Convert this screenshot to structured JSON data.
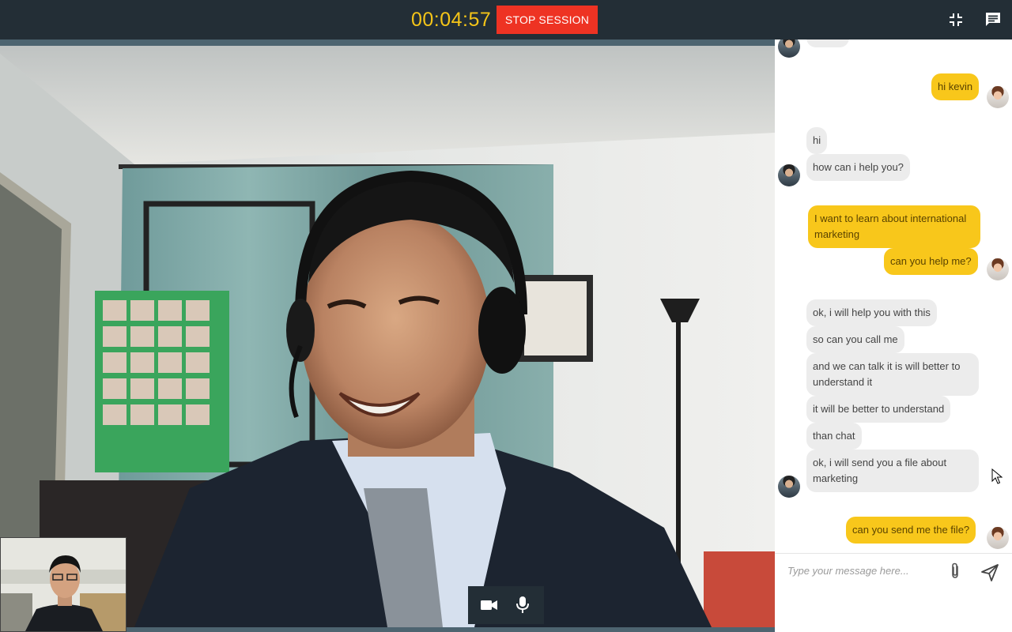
{
  "header": {
    "timer": "00:04:57",
    "stop_button_label": "STOP SESSION",
    "icons": [
      "minimize-icon",
      "chat-icon"
    ],
    "timer_color": "#f5c518",
    "stop_color": "#ee3323"
  },
  "video": {
    "controls": [
      "video-camera-icon",
      "microphone-icon"
    ]
  },
  "chat": {
    "bubble_me_color": "#f8c71b",
    "bubble_them_color": "#ececec",
    "messages": [
      {
        "from": "them",
        "text": "hi"
      },
      {
        "from": "them",
        "text": "how can i help you?"
      },
      {
        "from": "me",
        "text": "hi kevin"
      },
      {
        "from": "me",
        "text": "I want to learn about international marketing"
      },
      {
        "from": "me",
        "text": "can you help me?"
      },
      {
        "from": "them",
        "text": "ok, i will help you with this"
      },
      {
        "from": "them",
        "text": "so can you call me"
      },
      {
        "from": "them",
        "text": "and we can talk it is will better to understand it"
      },
      {
        "from": "them",
        "text": "it will be better to understand"
      },
      {
        "from": "them",
        "text": "than chat"
      },
      {
        "from": "them",
        "text": "ok, i will send you a file about marketing"
      },
      {
        "from": "me",
        "text": "can you send me the file?"
      }
    ],
    "input_placeholder": "Type your message here...",
    "input_value": ""
  }
}
